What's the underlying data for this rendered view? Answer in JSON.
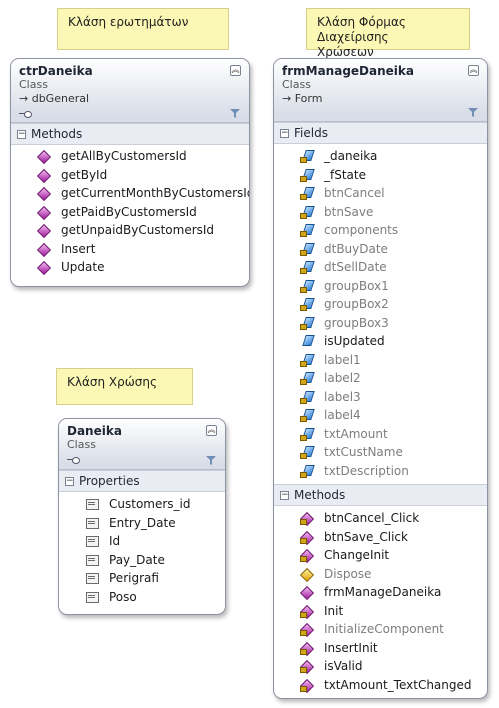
{
  "notes": {
    "queries": "Κλάση ερωτημάτων",
    "form": "Κλάση Φόρμας Διαχείρισης Χρώσεων",
    "debt": "Κλάση Χρώσης"
  },
  "ctrDaneika": {
    "title": "ctrDaneika",
    "kind": "Class",
    "inherits": "→ dbGeneral",
    "methods_label": "Methods",
    "methods": [
      "getAllByCustomersId",
      "getById",
      "getCurrentMonthByCustomersId",
      "getPaidByCustomersId",
      "getUnpaidByCustomersId",
      "Insert",
      "Update"
    ]
  },
  "frmManageDaneika": {
    "title": "frmManageDaneika",
    "kind": "Class",
    "inherits": "→ Form",
    "fields_label": "Fields",
    "fields": [
      "_daneika",
      "_fState",
      "btnCancel",
      "btnSave",
      "components",
      "dtBuyDate",
      "dtSellDate",
      "groupBox1",
      "groupBox2",
      "groupBox3",
      "isUpdated",
      "label1",
      "label2",
      "label3",
      "label4",
      "txtAmount",
      "txtCustName",
      "txtDescription"
    ],
    "methods_label": "Methods",
    "methods": [
      "btnCancel_Click",
      "btnSave_Click",
      "ChangeInit",
      "Dispose",
      "frmManageDaneika",
      "Init",
      "InitializeComponent",
      "InsertInit",
      "isValid",
      "txtAmount_TextChanged"
    ]
  },
  "Daneika": {
    "title": "Daneika",
    "kind": "Class",
    "properties_label": "Properties",
    "properties": [
      "Customers_id",
      "Entry_Date",
      "Id",
      "Pay_Date",
      "Perigrafi",
      "Poso"
    ]
  }
}
